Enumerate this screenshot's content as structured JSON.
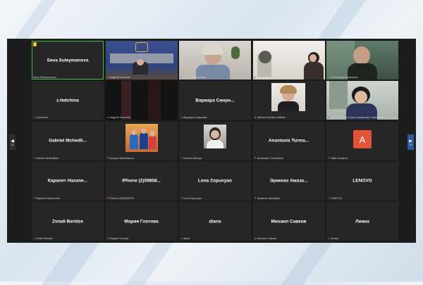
{
  "window": {
    "title": ""
  },
  "navigation": {
    "prev": {
      "arrow": "◀",
      "page": "1/2"
    },
    "next": {
      "arrow": "▶",
      "page": "1/2"
    }
  },
  "tiles": [
    {
      "name": "Seva Suleymanova",
      "label": "Seva Suleymanova",
      "video": false,
      "active": true,
      "hand": true,
      "muted": false
    },
    {
      "name": "",
      "label": "Андрей Ильичев",
      "video": true,
      "muted": false
    },
    {
      "name": "",
      "label": "Ольга Красовская",
      "video": true,
      "muted": true
    },
    {
      "name": "",
      "label": "Ксения Озерова",
      "video": true,
      "muted": true
    },
    {
      "name": "",
      "label": "Александр Карапетян",
      "video": true,
      "muted": true
    },
    {
      "name": "z.fedchina",
      "label": "z.fedchina",
      "video": false,
      "muted": true
    },
    {
      "name": "",
      "label": "Андрей Ильичев",
      "video": false,
      "muted": true
    },
    {
      "name": "Варвара Синрн...",
      "label": "Варвара Синрнова",
      "video": false,
      "muted": true
    },
    {
      "name": "",
      "label": "Valeria Kushkin Institute",
      "video": true,
      "muted": true
    },
    {
      "name": "",
      "label": "Артём Гресто Сэрга Ананасова Чимбаровкс Эндоре",
      "video": true,
      "muted": true
    },
    {
      "name": "Gabriel Mchedli...",
      "label": "Gabriel Mchedlidze",
      "video": false,
      "muted": true
    },
    {
      "name": "",
      "label": "Nargiza Nazdulaeva",
      "video": true,
      "muted": true
    },
    {
      "name": "",
      "label": "Ксения Абосуа",
      "video": true,
      "muted": true
    },
    {
      "name": "Anastasia Turma...",
      "label": "Anastasia Turmanidze",
      "video": false,
      "muted": true
    },
    {
      "name": "",
      "label": "Irakli Dzadzua",
      "video": false,
      "avatar": "A",
      "muted": true
    },
    {
      "name": "Карапет Нахапе...",
      "label": "Карапет Нахапетян",
      "video": false,
      "muted": true
    },
    {
      "name": "iPhone (2)59858...",
      "label": "iPhone (2)59858705",
      "video": false,
      "muted": true
    },
    {
      "name": "Lena Zopunyan",
      "label": "Lena Zopunyan",
      "video": false,
      "muted": true
    },
    {
      "name": "Эрикназ Амаза...",
      "label": "Эрикназ Амазарян",
      "video": false,
      "muted": true
    },
    {
      "name": "LENOVO",
      "label": "LENOVO",
      "video": false,
      "muted": true
    },
    {
      "name": "Zviadi Beridze",
      "label": "Zviadi Beridze",
      "video": false,
      "muted": true
    },
    {
      "name": "Мария Глотова",
      "label": "Мария Глотова",
      "video": false,
      "muted": true
    },
    {
      "name": "diana",
      "label": "diana",
      "video": false,
      "muted": true
    },
    {
      "name": "Михаил Савков",
      "label": "Михаил Савков",
      "video": false,
      "muted": true
    },
    {
      "name": "Лиана",
      "label": "Лиана",
      "video": false,
      "muted": true
    }
  ]
}
